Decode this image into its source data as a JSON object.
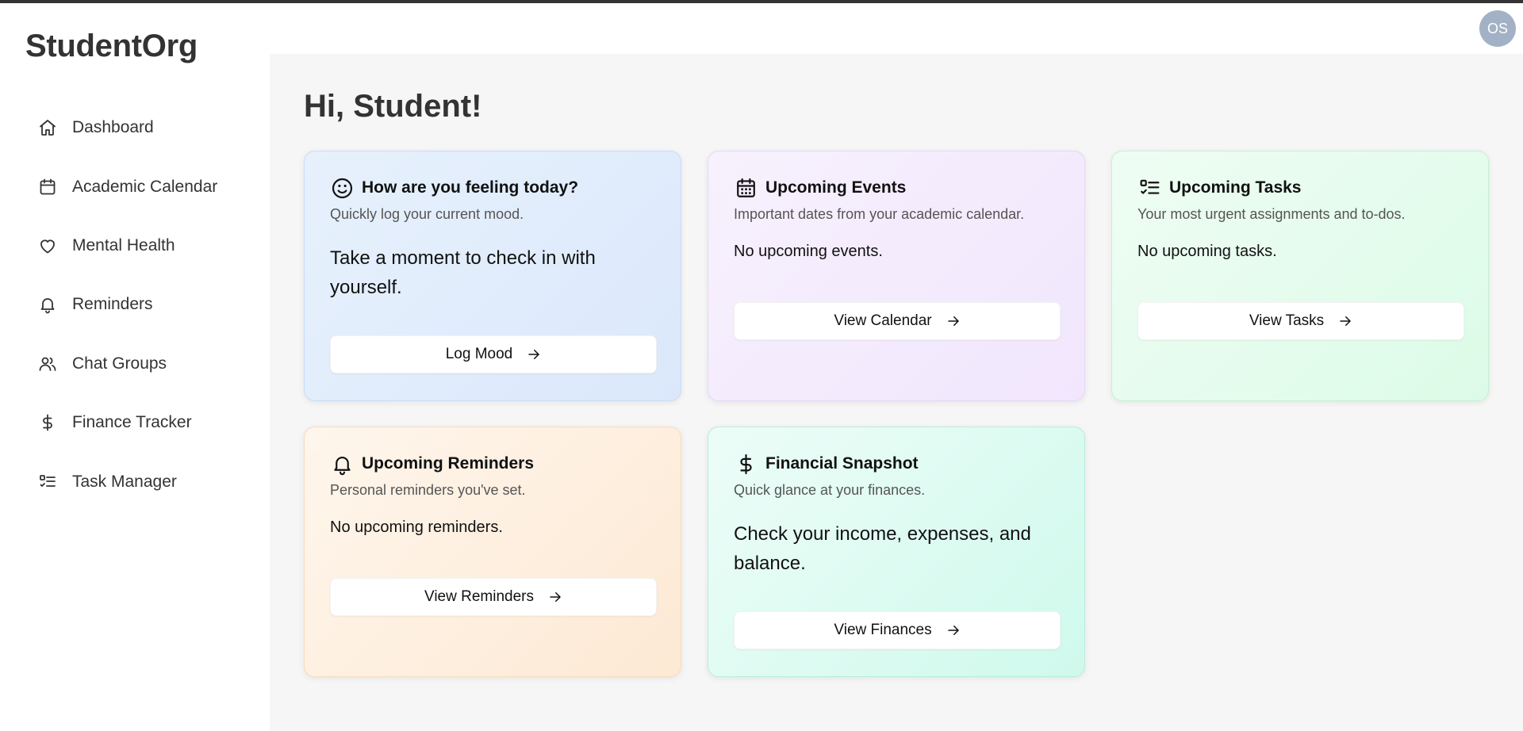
{
  "app": {
    "brand": "StudentOrg",
    "avatar_initials": "OS"
  },
  "sidebar": {
    "items": [
      {
        "label": "Dashboard",
        "icon": "home-icon"
      },
      {
        "label": "Academic Calendar",
        "icon": "calendar-icon"
      },
      {
        "label": "Mental Health",
        "icon": "heart-icon"
      },
      {
        "label": "Reminders",
        "icon": "bell-icon"
      },
      {
        "label": "Chat Groups",
        "icon": "users-icon"
      },
      {
        "label": "Finance Tracker",
        "icon": "dollar-icon"
      },
      {
        "label": "Task Manager",
        "icon": "list-checks-icon"
      }
    ]
  },
  "main": {
    "greeting": "Hi, Student!",
    "cards": {
      "mood": {
        "title": "How are you feeling today?",
        "subtitle": "Quickly log your current mood.",
        "body": "Take a moment to check in with yourself.",
        "button": "Log Mood",
        "icon": "smile-icon",
        "color": "#dbe8fb"
      },
      "events": {
        "title": "Upcoming Events",
        "subtitle": "Important dates from your academic calendar.",
        "body": "No upcoming events.",
        "button": "View Calendar",
        "icon": "calendar-days-icon",
        "color": "#f1e6fd"
      },
      "tasks": {
        "title": "Upcoming Tasks",
        "subtitle": "Your most urgent assignments and to-dos.",
        "body": "No upcoming tasks.",
        "button": "View Tasks",
        "icon": "list-checks-icon",
        "color": "#dcfbe7"
      },
      "reminders": {
        "title": "Upcoming Reminders",
        "subtitle": "Personal reminders you've set.",
        "body": "No upcoming reminders.",
        "button": "View Reminders",
        "icon": "bell-icon",
        "color": "#fde9d4"
      },
      "finance": {
        "title": "Financial Snapshot",
        "subtitle": "Quick glance at your finances.",
        "body": "Check your income, expenses, and balance.",
        "button": "View Finances",
        "icon": "dollar-icon",
        "color": "#cff9ec"
      }
    }
  }
}
